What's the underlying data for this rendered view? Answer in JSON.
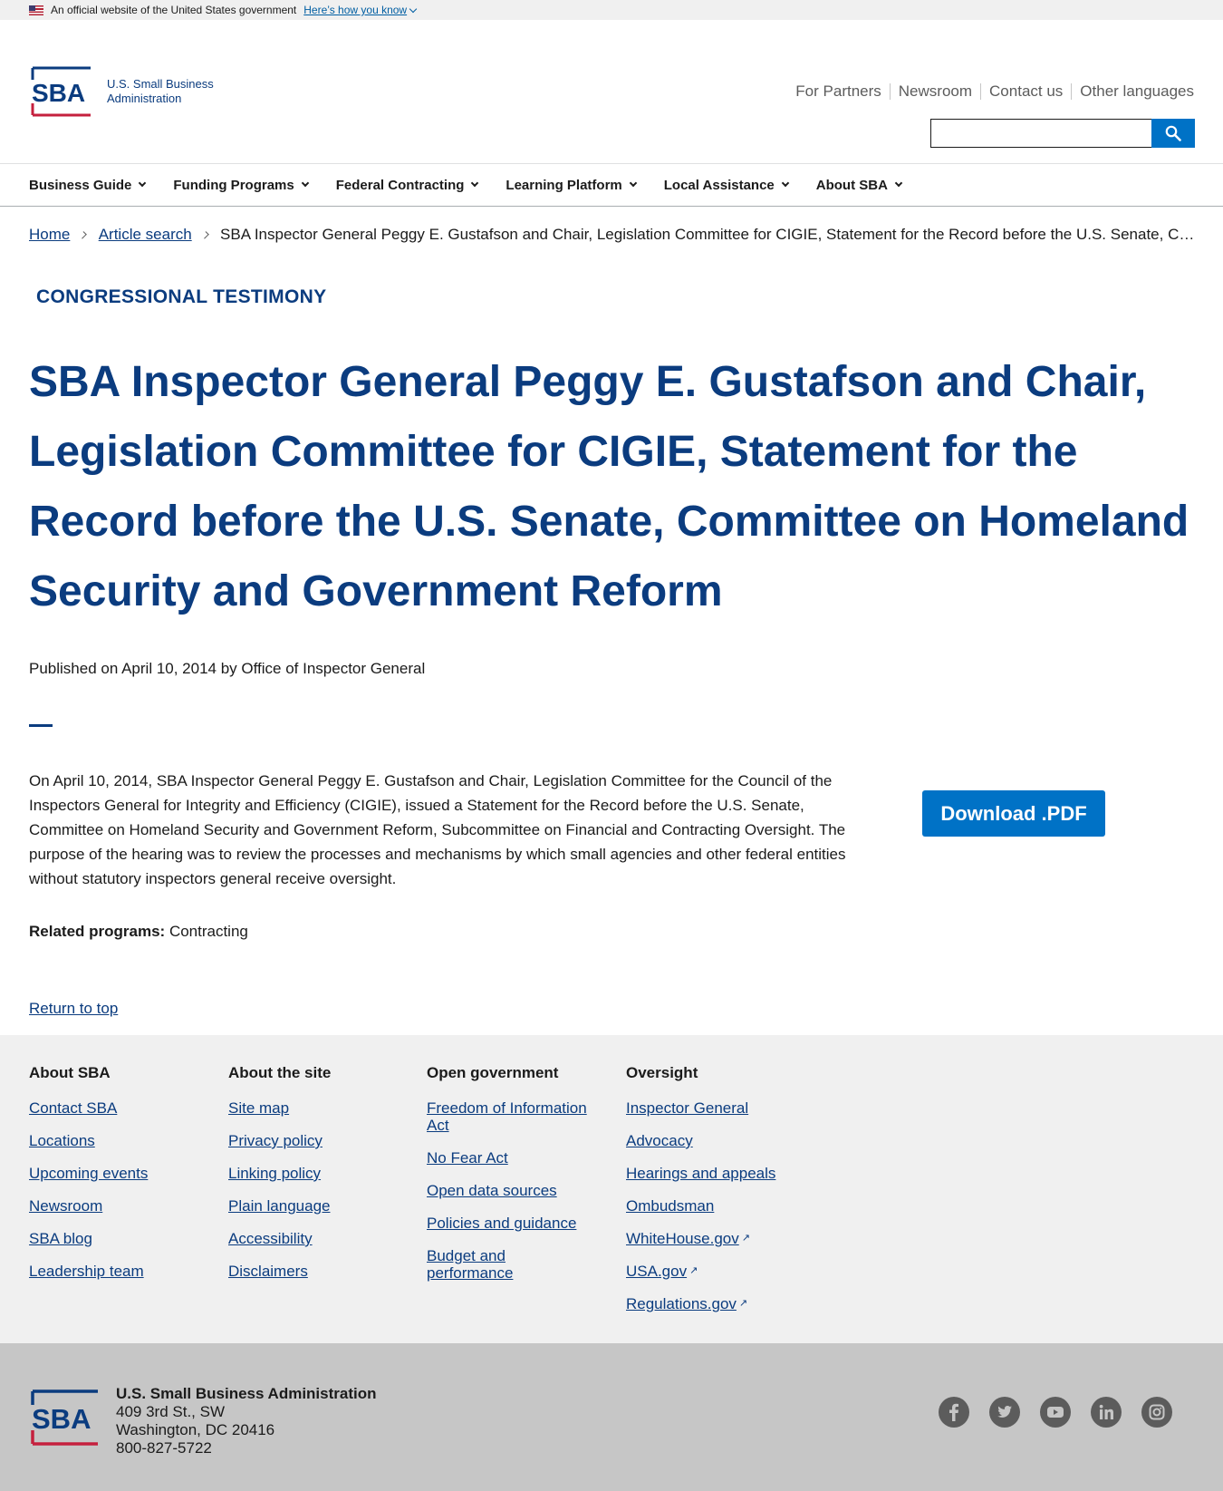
{
  "gov_banner": {
    "text": "An official website of the United States government",
    "link": "Here’s how you know"
  },
  "logo": {
    "mark": "SBA",
    "name": "U.S. Small Business Administration"
  },
  "utility_nav": [
    "For Partners",
    "Newsroom",
    "Contact us",
    "Other languages"
  ],
  "search": {
    "placeholder": "",
    "value": ""
  },
  "main_nav": [
    "Business Guide",
    "Funding Programs",
    "Federal Contracting",
    "Learning Platform",
    "Local Assistance",
    "About SBA"
  ],
  "breadcrumb": {
    "home": "Home",
    "article_search": "Article search",
    "current": "SBA Inspector General Peggy E. Gustafson and Chair, Legislation Committee for CIGIE, Statement for the Record before the U.S. Senate, Committee on Homeland Security and Government Reform"
  },
  "article": {
    "category": "CONGRESSIONAL TESTIMONY",
    "title": "SBA Inspector General Peggy E. Gustafson and Chair, Legislation Committee for CIGIE, Statement for the Record before the U.S. Senate, Committee on Homeland Security and Government Reform",
    "published": "Published on April 10, 2014 by Office of Inspector General",
    "body": "On April 10, 2014, SBA Inspector General Peggy E. Gustafson and Chair, Legislation Committee for the Council of the Inspectors General for Integrity and Efficiency (CIGIE), issued a Statement for the Record before the U.S. Senate, Committee on Homeland Security and Government Reform, Subcommittee on Financial and Contracting Oversight.  The purpose of the hearing was to review the processes and mechanisms by which small agencies and other federal entities without statutory inspectors general receive oversight.",
    "download_label": "Download .PDF",
    "related_label": "Related programs:",
    "related_value": "Contracting",
    "return_top": "Return to top"
  },
  "footer": {
    "columns": [
      {
        "heading": "About SBA",
        "links": [
          "Contact SBA",
          "Locations",
          "Upcoming events",
          "Newsroom",
          "SBA blog",
          "Leadership team"
        ]
      },
      {
        "heading": "About the site",
        "links": [
          "Site map",
          "Privacy policy",
          "Linking policy",
          "Plain language",
          "Accessibility",
          "Disclaimers"
        ]
      },
      {
        "heading": "Open government",
        "links": [
          "Freedom of Information Act",
          "No Fear Act",
          "Open data sources",
          "Policies and guidance",
          "Budget and performance"
        ]
      },
      {
        "heading": "Oversight",
        "links": [
          "Inspector General",
          "Advocacy",
          "Hearings and appeals",
          "Ombudsman",
          "WhiteHouse.gov",
          "USA.gov",
          "Regulations.gov"
        ]
      }
    ],
    "org_name": "U.S. Small Business Administration",
    "address_line1": "409 3rd St., SW",
    "address_line2": "Washington, DC 20416",
    "phone": "800-827-5722",
    "social_icons": [
      "facebook-icon",
      "twitter-icon",
      "youtube-icon",
      "linkedin-icon",
      "instagram-icon"
    ]
  },
  "colors": {
    "navy": "#0b3c7f",
    "button_blue": "#0072c6",
    "footer_gray": "#f0f0f0",
    "footer_dark": "#c6c6c6",
    "logo_red": "#c5203e"
  }
}
